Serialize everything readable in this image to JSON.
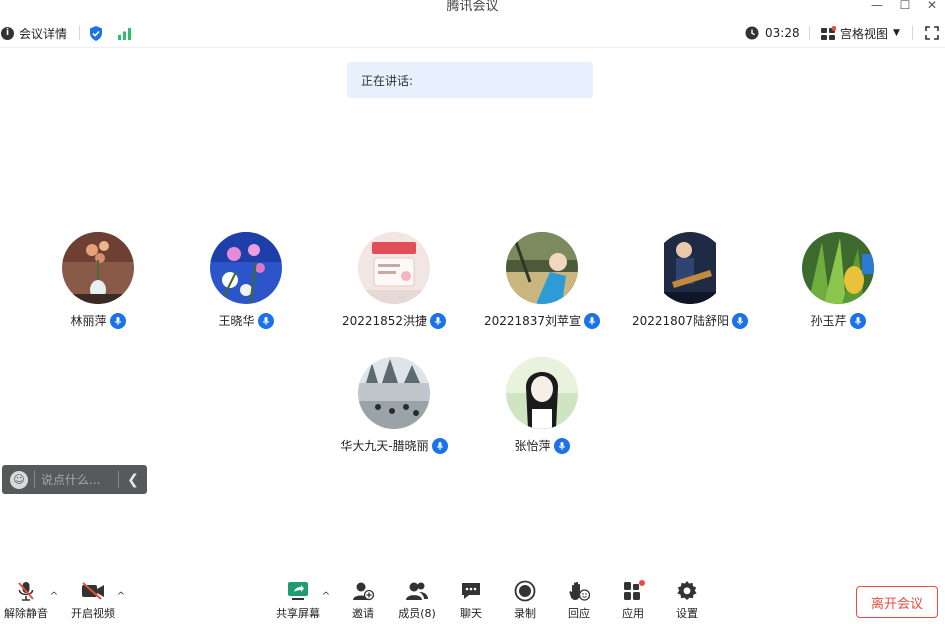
{
  "window": {
    "title": "腾讯会议"
  },
  "infobar": {
    "meeting_details": "会议详情",
    "timer": "03:28",
    "view_mode": "宫格视图"
  },
  "speaking": {
    "label": "正在讲话:"
  },
  "participants": [
    {
      "name": "林丽萍"
    },
    {
      "name": "王晓华"
    },
    {
      "name": "20221852洪捷"
    },
    {
      "name": "20221837刘苹宣"
    },
    {
      "name": "20221807陆舒阳"
    },
    {
      "name": "孙玉芹"
    },
    {
      "name": "华大九天-腊晓丽"
    },
    {
      "name": "张怡萍"
    }
  ],
  "chat": {
    "placeholder": "说点什么..."
  },
  "toolbar": {
    "unmute": "解除静音",
    "start_video": "开启视频",
    "share_screen": "共享屏幕",
    "invite": "邀请",
    "members": "成员(8)",
    "chat": "聊天",
    "record": "录制",
    "reactions": "回应",
    "apps": "应用",
    "settings": "设置",
    "leave": "离开会议"
  },
  "colors": {
    "accent": "#1a73e8",
    "signal": "#2dbd6e",
    "danger": "#e94e40",
    "speaking_bg": "#e8f0fd"
  }
}
